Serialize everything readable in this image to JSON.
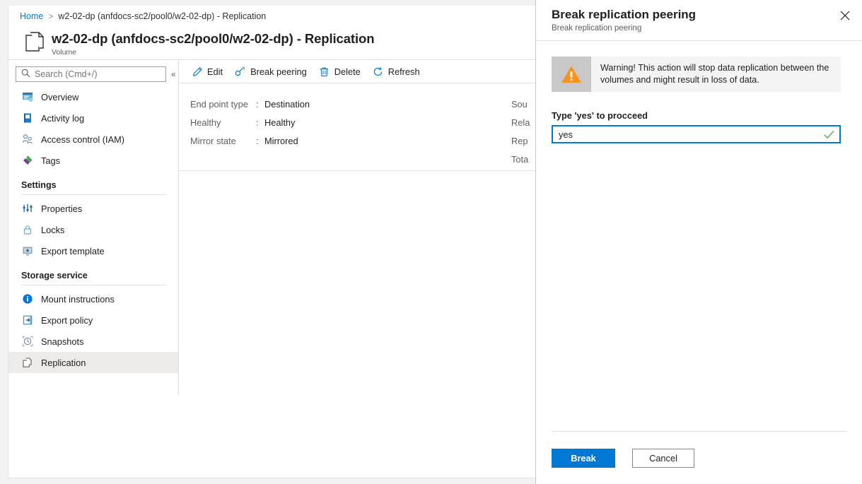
{
  "breadcrumb": {
    "home": "Home",
    "separator": ">",
    "current": "w2-02-dp (anfdocs-sc2/pool0/w2-02-dp) - Replication"
  },
  "header": {
    "title": "w2-02-dp (anfdocs-sc2/pool0/w2-02-dp) - Replication",
    "subtitle": "Volume",
    "icon": "volume-icon"
  },
  "sidebar": {
    "search": {
      "placeholder": "Search (Cmd+/)",
      "value": "",
      "icon": "search-icon",
      "collapse_icon": "chevron-double-left-icon"
    },
    "items": [
      {
        "label": "Overview",
        "icon": "overview-icon",
        "selected": false
      },
      {
        "label": "Activity log",
        "icon": "activity-log-icon",
        "selected": false
      },
      {
        "label": "Access control (IAM)",
        "icon": "access-control-icon",
        "selected": false
      },
      {
        "label": "Tags",
        "icon": "tags-icon",
        "selected": false
      }
    ],
    "sections": [
      {
        "title": "Settings",
        "items": [
          {
            "label": "Properties",
            "icon": "properties-icon",
            "selected": false
          },
          {
            "label": "Locks",
            "icon": "lock-icon",
            "selected": false
          },
          {
            "label": "Export template",
            "icon": "export-template-icon",
            "selected": false
          }
        ]
      },
      {
        "title": "Storage service",
        "items": [
          {
            "label": "Mount instructions",
            "icon": "info-icon",
            "selected": false
          },
          {
            "label": "Export policy",
            "icon": "export-policy-icon",
            "selected": false
          },
          {
            "label": "Snapshots",
            "icon": "snapshots-icon",
            "selected": false
          },
          {
            "label": "Replication",
            "icon": "replication-icon",
            "selected": true
          }
        ]
      }
    ]
  },
  "toolbar": {
    "buttons": [
      {
        "label": "Edit",
        "icon": "pencil-icon"
      },
      {
        "label": "Break peering",
        "icon": "break-peering-icon"
      },
      {
        "label": "Delete",
        "icon": "trash-icon"
      },
      {
        "label": "Refresh",
        "icon": "refresh-icon"
      }
    ]
  },
  "properties": {
    "left": [
      {
        "key": "End point type",
        "value": "Destination"
      },
      {
        "key": "Healthy",
        "value": "Healthy"
      },
      {
        "key": "Mirror state",
        "value": "Mirrored"
      }
    ],
    "right_clipped": [
      "Sou",
      "Rela",
      "Rep",
      "Tota"
    ],
    "collapse_icon": "chevron-double-up-icon"
  },
  "panel": {
    "title": "Break replication peering",
    "subtitle": "Break replication peering",
    "close_icon": "close-icon",
    "warning": {
      "icon": "warning-triangle-icon",
      "text": "Warning! This action will stop data replication between the volumes and might result in loss of data."
    },
    "confirm": {
      "label": "Type 'yes' to procceed",
      "value": "yes",
      "placeholder": "",
      "validation_icon": "checkmark-icon"
    },
    "footer": {
      "primary": "Break",
      "secondary": "Cancel"
    }
  },
  "colors": {
    "accent": "#0078d4",
    "warning": "#f7941d",
    "success": "#107c10",
    "selected_row": "#edebe9"
  }
}
